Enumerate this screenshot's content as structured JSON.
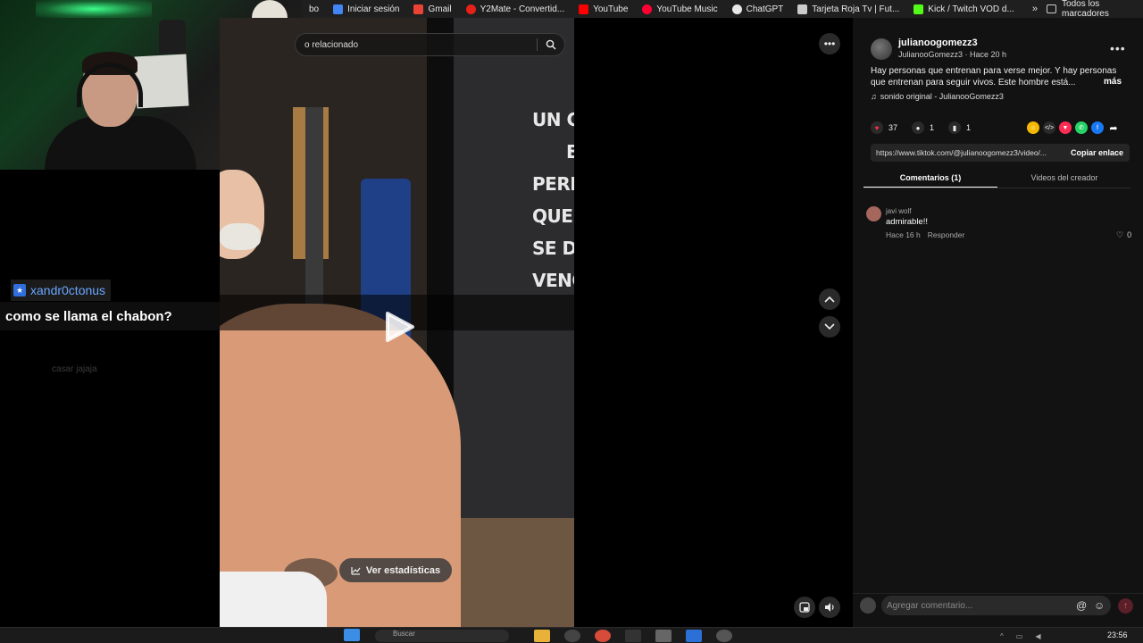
{
  "bookmarks": {
    "partial_first": "bo",
    "items": [
      {
        "label": "Iniciar sesión",
        "icon": "google-icon",
        "color": "#4285f4"
      },
      {
        "label": "Gmail",
        "icon": "gmail-icon",
        "color": "#ea4335"
      },
      {
        "label": "Y2Mate - Convertid...",
        "icon": "y2mate-icon",
        "color": "#e62117"
      },
      {
        "label": "YouTube",
        "icon": "youtube-icon",
        "color": "#ff0000"
      },
      {
        "label": "YouTube Music",
        "icon": "youtube-music-icon",
        "color": "#ff0033"
      },
      {
        "label": "ChatGPT",
        "icon": "chatgpt-icon",
        "color": "#e8e8e8"
      },
      {
        "label": "Tarjeta Roja Tv | Fut...",
        "icon": "tarjeta-roja-icon",
        "color": "#cccccc"
      },
      {
        "label": "Kick / Twitch VOD d...",
        "icon": "kick-icon",
        "color": "#53fc18"
      }
    ],
    "more_label": "»",
    "all_label": "Todos los marcadores"
  },
  "search": {
    "text": "o relacionado"
  },
  "video": {
    "wall_text": [
      "UN GAN",
      "E",
      "PERDI",
      "QUE JA",
      "SE DIO",
      "VENC"
    ],
    "stats_button": "Ver estadísticas"
  },
  "chat": {
    "username": "xandr0ctonus",
    "message": "como se llama el chabon?",
    "faded_message": "casar jajaja"
  },
  "post": {
    "username": "julianoogomezz3",
    "subline": "JulianooGomezz3 · Hace 20 h",
    "description": "Hay personas que entrenan para verse mejor. Y hay personas que entrenan para seguir vivos. Este hombre está...",
    "more": "más",
    "sound": "sonido original - JulianooGomezz3",
    "likes": "37",
    "comments": "1",
    "saves": "1",
    "link": "https://www.tiktok.com/@julianoogomezz3/video/...",
    "copy_label": "Copiar enlace"
  },
  "tabs": [
    {
      "label": "Comentarios (1)",
      "active": true
    },
    {
      "label": "Videos del creador",
      "active": false
    }
  ],
  "comment": {
    "user": "javi wolf",
    "text": "admirable!!",
    "time": "Hace 16 h",
    "reply": "Responder",
    "likes": "0"
  },
  "comment_input": {
    "placeholder": "Agregar comentario..."
  },
  "taskbar": {
    "search": "Buscar",
    "time": "23:56"
  },
  "colors": {
    "accent": "#fe2c55",
    "panel_bg": "#121212",
    "chat_name": "#6aa6ff"
  }
}
